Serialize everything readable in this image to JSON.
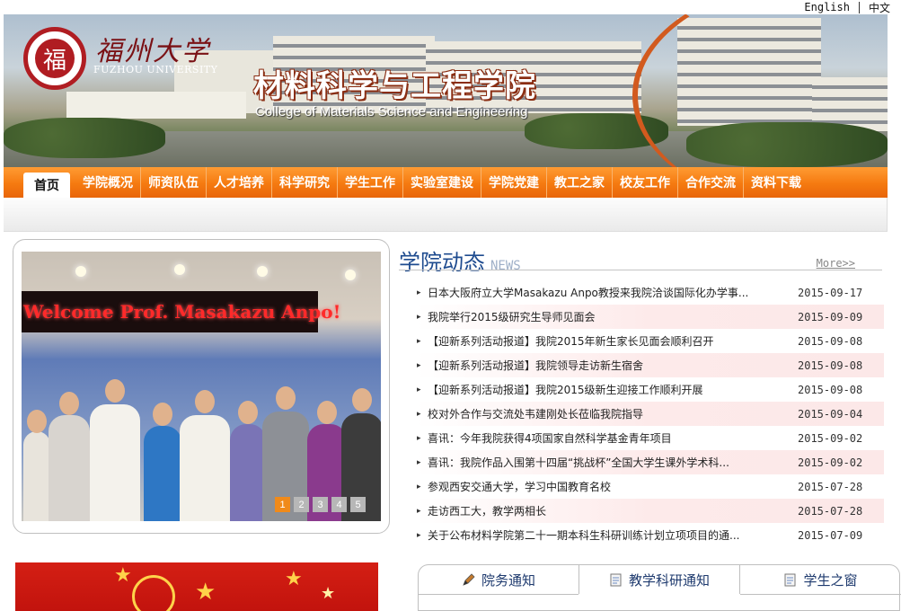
{
  "lang": {
    "english": "English",
    "chinese": "中文"
  },
  "banner": {
    "logo_char": "福",
    "university_cn": "福州大学",
    "university_en": "FUZHOU UNIVERSITY",
    "college_cn": "材料科学与工程学院",
    "college_en": "College of Materials Science and Engineering"
  },
  "nav": {
    "items": [
      "首页",
      "学院概况",
      "师资队伍",
      "人才培养",
      "科学研究",
      "学生工作",
      "实验室建设",
      "学院党建",
      "教工之家",
      "校友工作",
      "合作交流",
      "资料下载"
    ]
  },
  "slideshow": {
    "caption": "Welcome Prof. Masakazu Anpo!",
    "pages": [
      "1",
      "2",
      "3",
      "4",
      "5"
    ],
    "current": 1
  },
  "news": {
    "title": "学院动态",
    "title_en": "NEWS",
    "more": "More>>",
    "items": [
      {
        "text": "日本大阪府立大学Masakazu Anpo教授来我院洽谈国际化办学事...",
        "date": "2015-09-17"
      },
      {
        "text": "我院举行2015级研究生导师见面会",
        "date": "2015-09-09"
      },
      {
        "text": "【迎新系列活动报道】我院2015年新生家长见面会顺利召开",
        "date": "2015-09-08"
      },
      {
        "text": "【迎新系列活动报道】我院领导走访新生宿舍",
        "date": "2015-09-08"
      },
      {
        "text": "【迎新系列活动报道】我院2015级新生迎接工作顺利开展",
        "date": "2015-09-08"
      },
      {
        "text": "校对外合作与交流处韦建刚处长莅临我院指导",
        "date": "2015-09-04"
      },
      {
        "text": "喜讯：今年我院获得4项国家自然科学基金青年项目",
        "date": "2015-09-02"
      },
      {
        "text": "喜讯：我院作品入围第十四届“挑战杯”全国大学生课外学术科...",
        "date": "2015-09-02"
      },
      {
        "text": "参观西安交通大学，学习中国教育名校",
        "date": "2015-07-28"
      },
      {
        "text": "走访西工大，教学两相长",
        "date": "2015-07-28"
      },
      {
        "text": "关于公布材料学院第二十一期本科生科研训练计划立项项目的通...",
        "date": "2015-07-09"
      }
    ]
  },
  "tabs": {
    "items": [
      {
        "label": "院务通知",
        "icon": "pen-icon"
      },
      {
        "label": "教学科研通知",
        "icon": "document-icon"
      },
      {
        "label": "学生之窗",
        "icon": "document-icon"
      }
    ],
    "active": 1
  },
  "colors": {
    "nav_orange": "#f57a10",
    "brand_red": "#b01d22",
    "news_blue": "#1e4b8f",
    "slide_dot_active": "#f08a1a"
  }
}
